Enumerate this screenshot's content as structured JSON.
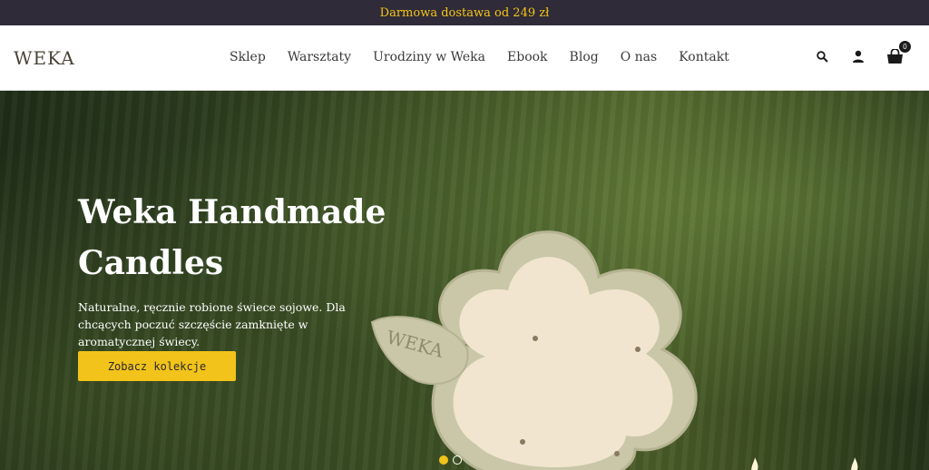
{
  "topbar": {
    "text": "Darmowa dostawa od 249 zł"
  },
  "header": {
    "logo": "WEKA",
    "nav": [
      "Sklep",
      "Warsztaty",
      "Urodziny w Weka",
      "Ebook",
      "Blog",
      "O nas",
      "Kontakt"
    ],
    "icons": {
      "search": "search-icon",
      "account": "user-icon",
      "cart": "cart-icon"
    },
    "cart_count": "0"
  },
  "hero": {
    "title": "Weka Handmade Candles",
    "subtitle": "Naturalne, ręcznie robione świece sojowe. Dla chcących poczuć szczęście zamknięte w aromatycznej świecy.",
    "button_label": "Zobacz kolekcje",
    "candle_engraving": "WEKA",
    "slides": {
      "count": 2,
      "active": 1
    }
  },
  "colors": {
    "accent": "#f2c31a",
    "topbar_bg": "#2f2b38"
  }
}
